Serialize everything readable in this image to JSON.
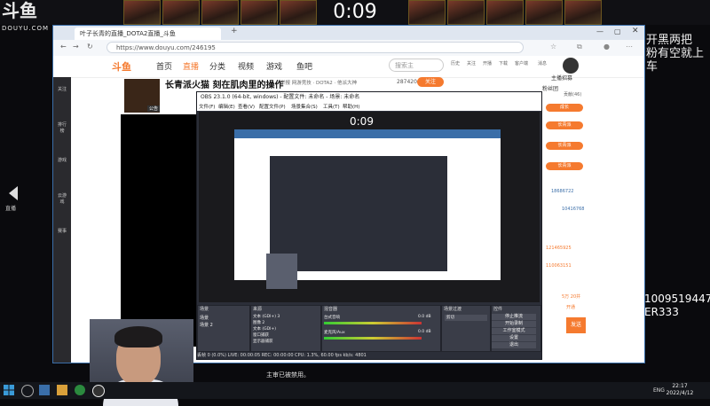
{
  "overlay": {
    "timer": "0:09",
    "logo": "斗鱼",
    "logo_sub": "DOUYU.COM",
    "side_text_1": "开黑两把",
    "side_text_2": "粉有空就上车",
    "side_number_1": "1009519447",
    "side_number_2": "ER333",
    "bottom_caption": "主审已被禁用。",
    "left_nav_label": "直播"
  },
  "browser": {
    "tab_title": "叶子长青的直播_DOTA2直播_斗鱼",
    "url": "https://www.douyu.com/246195",
    "nav": {
      "logo": "斗鱼",
      "items": [
        "首页",
        "直播",
        "分类",
        "视频",
        "游戏",
        "鱼吧"
      ],
      "search_placeholder": "搜索主",
      "right_icons": [
        "历史",
        "关注",
        "开播",
        "下载",
        "客户端",
        "消息",
        "头像"
      ]
    },
    "left_sidebar": [
      "关注",
      "排行榜",
      "游戏",
      "云游戏",
      "赛事"
    ],
    "stream_title": "长青派火猫 刻在肌肉里的操作",
    "stream_meta": "举报  网游竞技 · DOTA2 · 他派大神",
    "viewer_count": "287420",
    "follow_label": "关注",
    "badge_gonggao": "公告",
    "chat_panel": {
      "hot_label": "主播招募",
      "gift_label": "粉丝团",
      "level_label": "贡献(46)",
      "badges": [
        "成长",
        "长青派",
        "长青派",
        "长青派"
      ],
      "ids": [
        "18686722",
        "10416768",
        "121465925",
        "110063151"
      ],
      "send_label": "发送",
      "open_label": "开通",
      "count_label": "5万 20井"
    }
  },
  "obs": {
    "title": "OBS 23.1.0 (64-bit, windows) - 配置文件: 未命名 - 场景: 未命名",
    "menu": [
      "文件(F)",
      "编辑(E)",
      "查看(V)",
      "配置文件(P)",
      "场景集合(S)",
      "工具(T)",
      "帮助(H)"
    ],
    "preview_timer": "0:09",
    "panels": {
      "scenes": "场景",
      "sources": "来源",
      "mixer": "混音器",
      "transitions": "场景过渡",
      "controls": "控件"
    },
    "scene_items": [
      "场景",
      "场景 2"
    ],
    "source_items": [
      "文本 (GDI+) 3",
      "图像 2",
      "文本 (GDI+)",
      "窗口捕获",
      "显示器捕获"
    ],
    "mixer_items": [
      {
        "name": "台式音响",
        "db": "0.0 dB"
      },
      {
        "name": "麦克风/Aux",
        "db": "0.0 dB"
      }
    ],
    "transition_value": "剪切",
    "buttons": [
      "停止推流",
      "开始录制",
      "工作室模式",
      "设置",
      "退出"
    ],
    "status": "丢帧 0 (0.0%)   LIVE: 00:00:05   REC: 00:00:00   CPU: 1.3%, 60.00 fps   kb/s: 4801"
  },
  "taskbar": {
    "lang": "ENG",
    "time": "22:17",
    "date": "2022/4/12"
  },
  "colors": {
    "accent": "#f57a2f",
    "obs_bg": "#2b2e38",
    "browser_blue": "#3a6ea8"
  }
}
